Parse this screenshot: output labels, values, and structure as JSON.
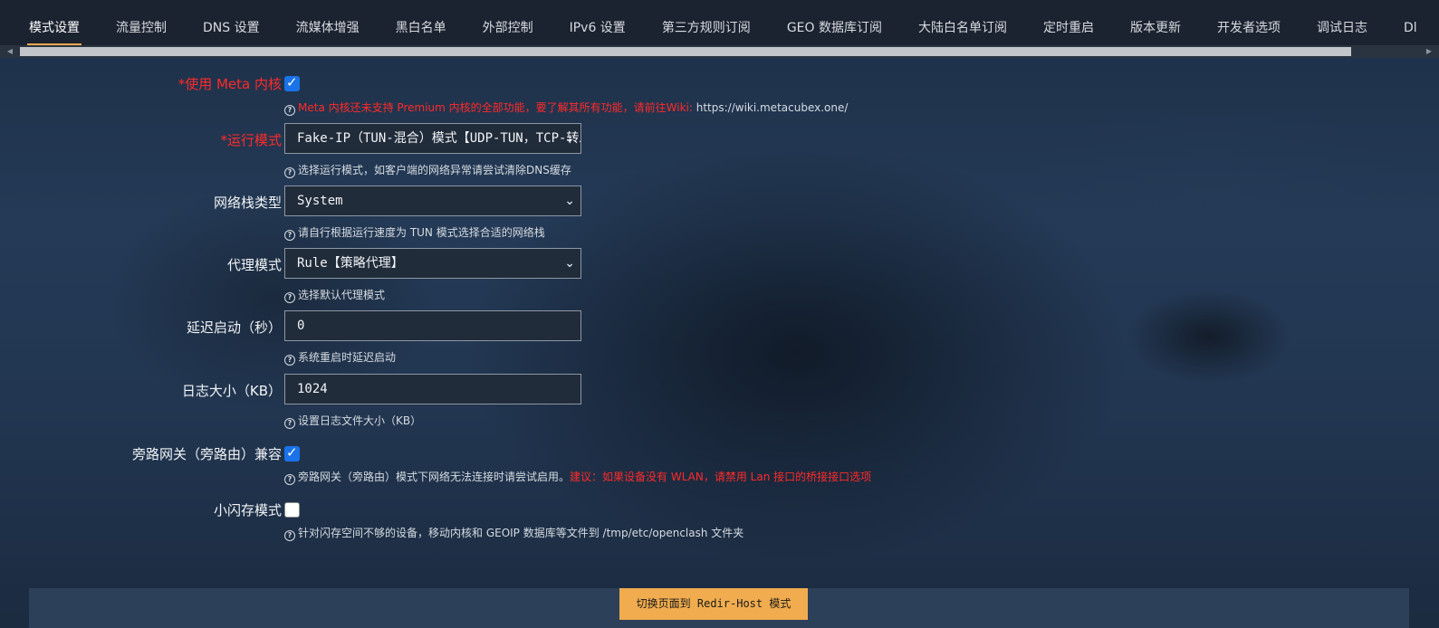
{
  "tabs": [
    {
      "label": "模式设置"
    },
    {
      "label": "流量控制"
    },
    {
      "label": "DNS 设置"
    },
    {
      "label": "流媒体增强"
    },
    {
      "label": "黑白名单"
    },
    {
      "label": "外部控制"
    },
    {
      "label": "IPv6 设置"
    },
    {
      "label": "第三方规则订阅"
    },
    {
      "label": "GEO 数据库订阅"
    },
    {
      "label": "大陆白名单订阅"
    },
    {
      "label": "定时重启"
    },
    {
      "label": "版本更新"
    },
    {
      "label": "开发者选项"
    },
    {
      "label": "调试日志"
    },
    {
      "label": "Dl"
    }
  ],
  "active_tab": "模式设置",
  "form": {
    "meta_core": {
      "label": "*使用 Meta 内核",
      "checked": true,
      "hint_red": "Meta 内核还未支持 Premium 内核的全部功能，要了解其所有功能，请前往Wiki:",
      "hint_link": "https://wiki.metacubex.one/"
    },
    "run_mode": {
      "label": "*运行模式",
      "value": "Fake-IP（TUN-混合）模式【UDP-TUN，TCP-转发】",
      "hint": "选择运行模式，如客户端的网络异常请尝试清除DNS缓存"
    },
    "stack_type": {
      "label": "网络栈类型",
      "value": "System",
      "hint": "请自行根据运行速度为 TUN 模式选择合适的网络栈"
    },
    "proxy_mode": {
      "label": "代理模式",
      "value": "Rule【策略代理】",
      "hint": "选择默认代理模式"
    },
    "delay_start": {
      "label": "延迟启动（秒）",
      "value": "0",
      "hint": "系统重启时延迟启动"
    },
    "log_size": {
      "label": "日志大小（KB）",
      "value": "1024",
      "hint": "设置日志文件大小（KB）"
    },
    "bypass_gateway": {
      "label": "旁路网关（旁路由）兼容",
      "checked": true,
      "hint": "旁路网关（旁路由）模式下网络无法连接时请尝试启用。",
      "hint_red": "建议：如果设备没有 WLAN，请禁用 Lan 接口的桥接接口选项"
    },
    "small_flash": {
      "label": "小闪存模式",
      "checked": false,
      "hint": "针对闪存空间不够的设备，移动内核和 GEOIP 数据库等文件到 /tmp/etc/openclash 文件夹"
    }
  },
  "footer": {
    "switch_label": "切换页面到 Redir-Host 模式"
  },
  "colors": {
    "accent": "#f0ac4e",
    "required_red": "#ff2a2a",
    "checkbox_blue": "#1a73e8",
    "tabbar_bg": "#1b2230"
  },
  "icons": {
    "hint": "question-circle-icon",
    "select": "chevron-down-icon",
    "scroll_left": "arrow-left-icon",
    "scroll_right": "arrow-right-icon"
  }
}
